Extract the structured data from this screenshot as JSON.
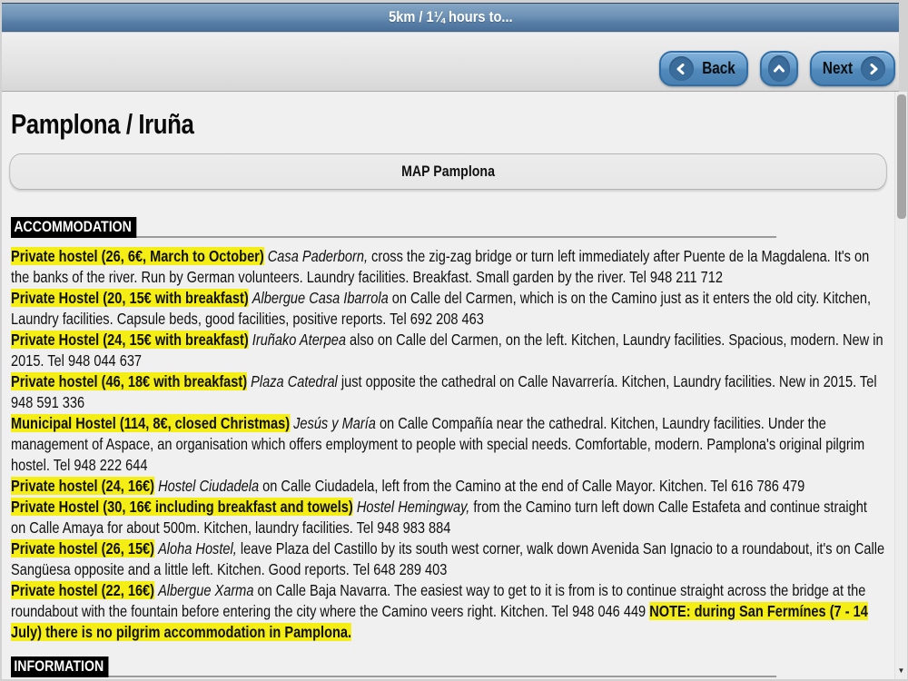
{
  "titlebar": {
    "text": "5km / 1¼ hours to..."
  },
  "toolbar": {
    "back_label": "Back",
    "next_label": "Next"
  },
  "page": {
    "title": "Pamplona / Iruña",
    "map_button_label": "MAP Pamplona"
  },
  "sections": {
    "accommodation": "ACCOMMODATION",
    "information": "INFORMATION"
  },
  "accommodation": {
    "entries": [
      {
        "highlight": "Private hostel (26, 6€, March to October)",
        "name": "Casa Paderborn,",
        "text": " cross the zig-zag bridge or turn left immediately after Puente de la Magdalena. It's on the banks of the river. Run by German volunteers. Laundry facilities. Breakfast. Small garden by the river. Tel 948 211 712"
      },
      {
        "highlight": "Private Hostel (20, 15€ with breakfast)",
        "name": "Albergue Casa Ibarrola",
        "text": " on Calle del Carmen, which is on the Camino just as it enters the old city. Kitchen, Laundry facilities. Capsule beds, good facilities, positive reports. Tel 692 208 463"
      },
      {
        "highlight": "Private Hostel (24, 15€ with breakfast)",
        "name": "Iruñako Aterpea",
        "text": " also on Calle del Carmen, on the left. Kitchen, Laundry facilities. Spacious, modern. New in 2015. Tel 948 044 637"
      },
      {
        "highlight": "Private hostel (46, 18€ with breakfast)",
        "name": "Plaza Catedral",
        "text": " just opposite the cathedral on Calle Navarrería. Kitchen, Laundry facilities. New in 2015. Tel 948 591 336"
      },
      {
        "highlight": "Municipal Hostel (114, 8€, closed Christmas)",
        "name": "Jesús y María",
        "text": " on Calle Compañía near the cathedral. Kitchen, Laundry facilities. Under the management of Aspace, an organisation which offers employment to people with special needs. Comfortable, modern. Pamplona's original pilgrim hostel. Tel 948 222 644"
      },
      {
        "highlight": "Private hostel (24, 16€)",
        "name": "Hostel Ciudadela",
        "text": " on Calle Ciudadela, left from the Camino at the end of Calle Mayor. Kitchen. Tel 616 786 479"
      },
      {
        "highlight": "Private Hostel (30, 16€ including breakfast and towels)",
        "name": "Hostel Hemingway,",
        "text": " from the Camino turn left down Calle Estafeta and continue straight on Calle Amaya for about 500m. Kitchen, laundry facilities. Tel 948 983 884"
      },
      {
        "highlight": "Private hostel (26, 15€)",
        "name": "Aloha Hostel,",
        "text": " leave Plaza del Castillo by its south west corner, walk down Avenida San Ignacio to a roundabout, it's on Calle Sangüesa opposite and a little left. Kitchen. Good reports. Tel 648 289 403"
      },
      {
        "highlight": "Private hostel (22, 16€)",
        "name": "Albergue Xarma",
        "text": " on Calle Baja Navarra. The easiest way to get to it is from is to continue straight across the bridge at the roundabout with the fountain before entering the city where the Camino veers right. Kitchen. Tel 948 046 449 ",
        "note": "NOTE: during San Fermínes (7 - 14 July) there is no pilgrim accommodation in Pamplona."
      }
    ]
  },
  "icons": {
    "down_arrow": "▼"
  },
  "colors": {
    "highlight_yellow": "#f5ee14",
    "titlebar_blue": "#5d87ae",
    "button_blue": "#5a92c1",
    "section_header_bg": "#000000"
  }
}
